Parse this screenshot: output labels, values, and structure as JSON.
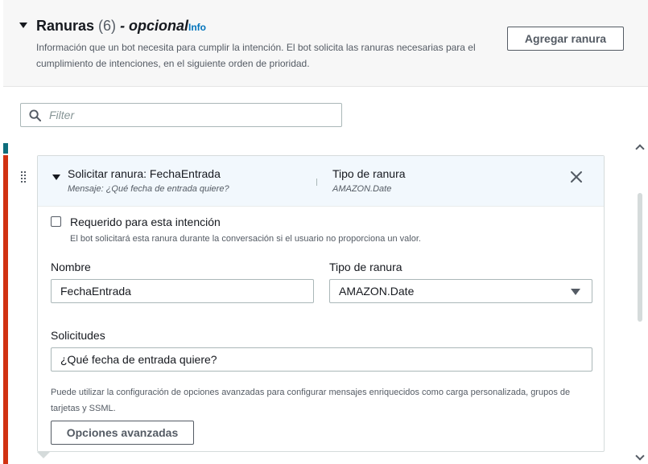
{
  "section": {
    "title": "Ranuras",
    "count": "(6)",
    "optional": "- opcional",
    "info_link": "Info",
    "description": "Información que un bot necesita para cumplir la intención. El bot solicita las ranuras necesarias para el cumplimiento de intenciones, en el siguiente orden de prioridad.",
    "add_button": "Agregar ranura"
  },
  "filter": {
    "placeholder": "Filter",
    "value": ""
  },
  "slot": {
    "header_title": "Solicitar ranura: FechaEntrada",
    "header_prompt": "Mensaje: ¿Qué fecha de entrada quiere?",
    "header_type_label": "Tipo de ranura",
    "header_type_value": "AMAZON.Date",
    "required_label": "Requerido para esta intención",
    "required_checked": false,
    "required_description": "El bot solicitará esta ranura durante la conversación si el usuario no proporciona un valor.",
    "name_label": "Nombre",
    "name_value": "FechaEntrada",
    "type_label": "Tipo de ranura",
    "type_value": "AMAZON.Date",
    "prompts_label": "Solicitudes",
    "prompts_value": "¿Qué fecha de entrada quiere?",
    "advanced_help": "Puede utilizar la configuración de opciones avanzadas para configurar mensajes enriquecidos como carga personalizada, grupos de tarjetas y SSML.",
    "advanced_button": "Opciones avanzadas"
  },
  "icons": {
    "search": "search-icon",
    "close": "close-icon",
    "drag": "drag-handle-icon",
    "expand": "caret-down-icon",
    "select": "caret-down-icon"
  },
  "colors": {
    "link": "#0073bb",
    "selected_bar": "#d13212",
    "teal_bar": "#0d6d7c",
    "header_bg": "#f2f8fd"
  }
}
